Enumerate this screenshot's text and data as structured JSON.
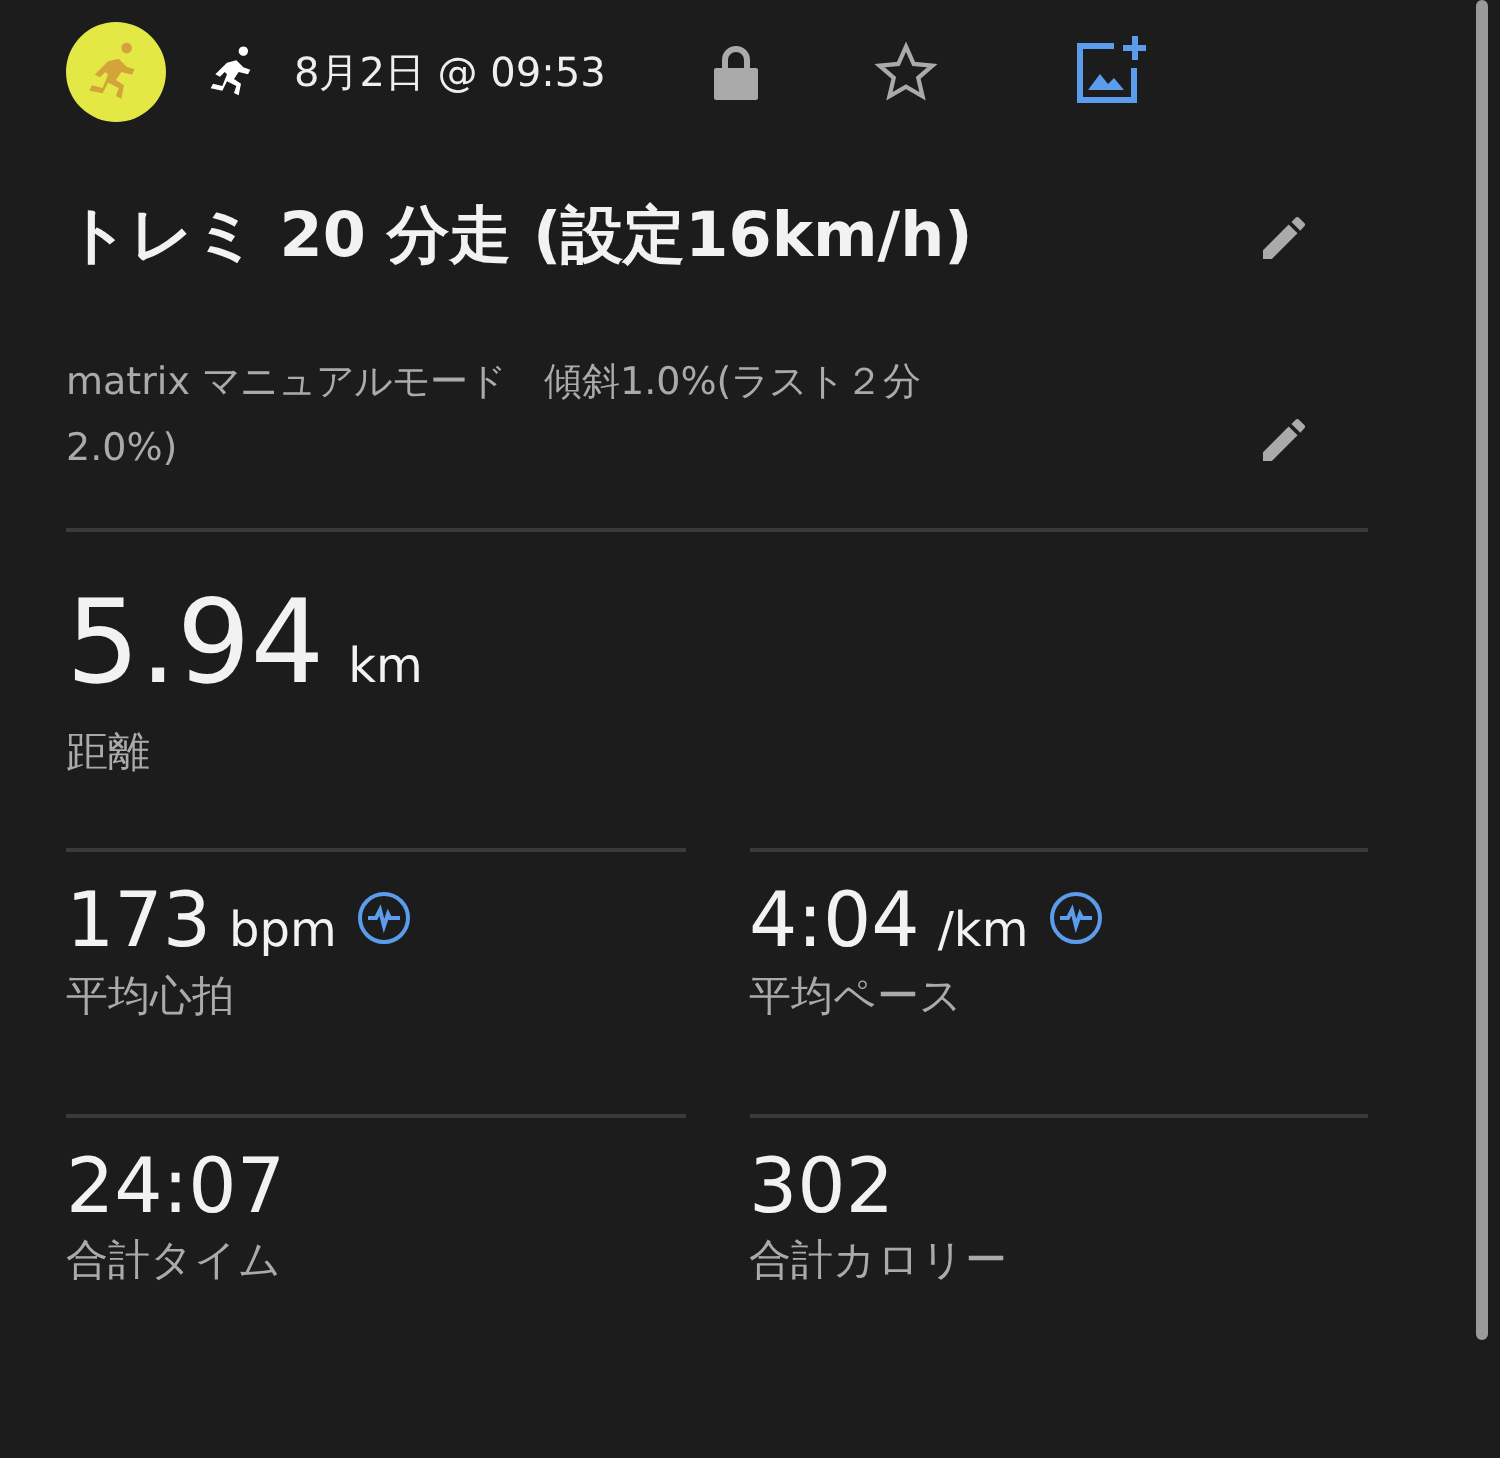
{
  "header": {
    "date": "8月2日 @ 09:53",
    "private": true,
    "favorite": false
  },
  "title": "トレミ 20 分走 (設定16km/h)",
  "description": "matrix マニュアルモード　傾斜1.0%(ラスト２分2.0%)",
  "main_stat": {
    "value": "5.94",
    "unit": "km",
    "label": "距離"
  },
  "stats": [
    {
      "kind": "metric-with-icon",
      "value": "173",
      "unit": "bpm",
      "label": "平均心拍"
    },
    {
      "kind": "metric-with-icon",
      "value": "4:04",
      "unit": "/km",
      "label": "平均ペース"
    },
    {
      "kind": "metric",
      "value": "24:07",
      "label": "合計タイム"
    },
    {
      "kind": "metric",
      "value": "302",
      "label": "合計カロリー"
    }
  ]
}
